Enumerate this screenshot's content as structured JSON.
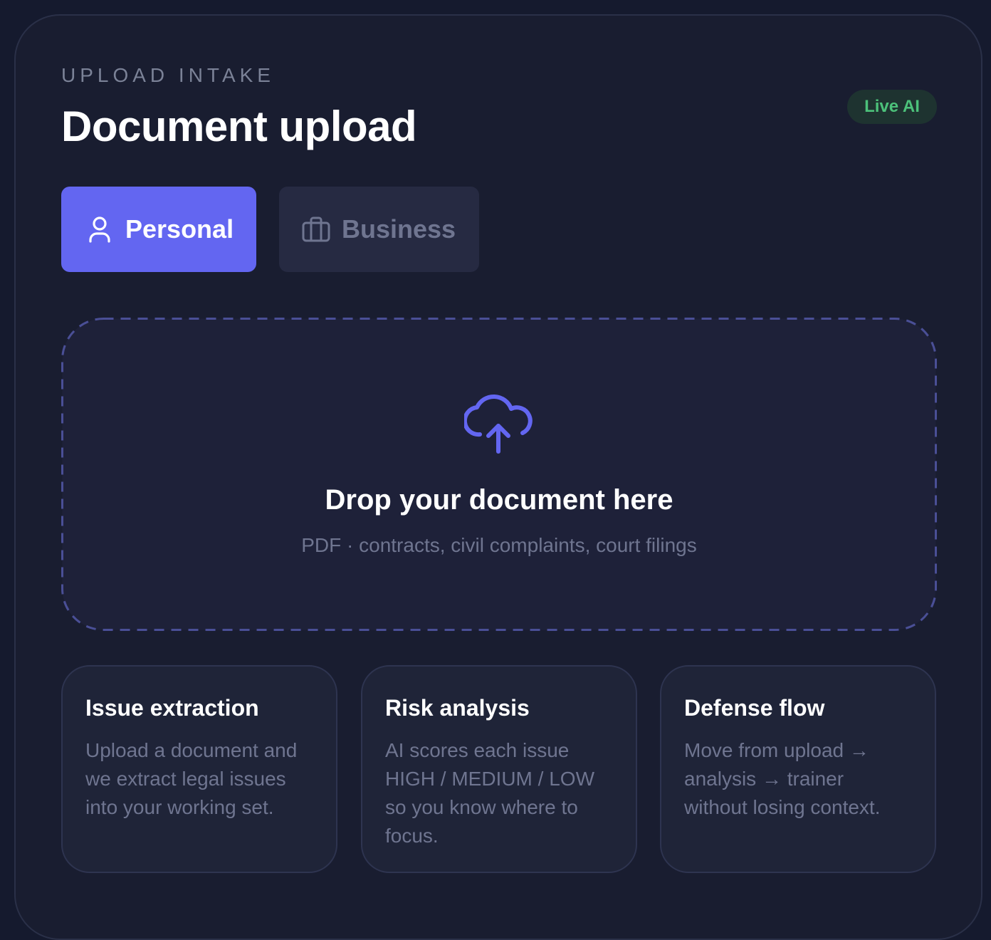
{
  "header": {
    "eyebrow": "UPLOAD INTAKE",
    "title": "Document upload",
    "badge": "Live AI"
  },
  "toggle": {
    "options": [
      {
        "label": "Personal",
        "icon": "user-icon",
        "selected": true
      },
      {
        "label": "Business",
        "icon": "briefcase-icon",
        "selected": false
      }
    ]
  },
  "dropzone": {
    "icon": "cloud-upload-icon",
    "title": "Drop your document here",
    "subtitle": "PDF · contracts, civil complaints, court filings"
  },
  "features": [
    {
      "title": "Issue extraction",
      "body": "Upload a document and we extract legal issues into your working set."
    },
    {
      "title": "Risk analysis",
      "body": "AI scores each issue HIGH / MEDIUM / LOW so you know where to focus."
    },
    {
      "title": "Defense flow",
      "body": "Move from upload → analysis → trainer without losing context."
    }
  ],
  "colors": {
    "accent": "#6366f1",
    "live": "#4cc17a",
    "background": "#191d30"
  }
}
